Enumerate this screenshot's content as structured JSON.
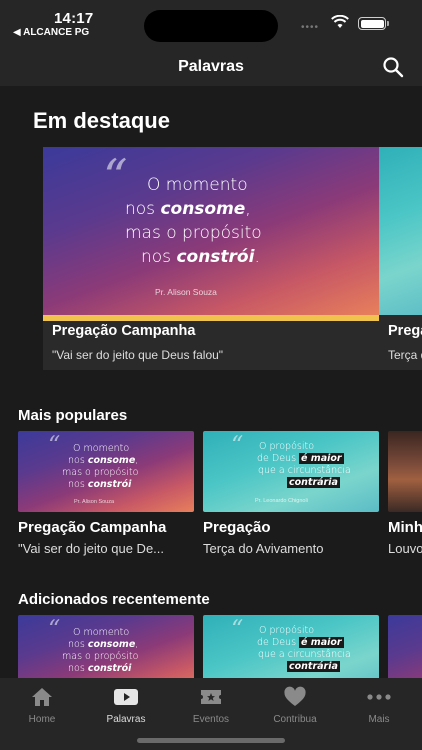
{
  "status": {
    "time": "14:17",
    "back_app": "◀ ALCANCE PG"
  },
  "nav": {
    "title": "Palavras"
  },
  "featured": {
    "section_title": "Em destaque",
    "cards": [
      {
        "title": "Pregação Campanha",
        "subtitle": "\"Vai ser do jeito que Deus falou\"",
        "art": {
          "line1": "O momento",
          "line2a": "nos ",
          "line2b": "consome",
          "line2c": ",",
          "line3": "mas o propósito",
          "line4a": "nos ",
          "line4b": "constrói",
          "line4c": ".",
          "author": "Pr. Alison Souza"
        }
      },
      {
        "title": "Pregação",
        "subtitle": "Terça do Avivamento"
      }
    ]
  },
  "popular": {
    "section_title": "Mais populares",
    "cards": [
      {
        "title": "Pregação Campanha",
        "subtitle": "\"Vai ser do jeito que De...",
        "art": {
          "line1": "O momento",
          "line2a": "nos ",
          "line2b": "consome",
          "line2c": ",",
          "line3": "mas o propósito",
          "line4a": "nos ",
          "line4b": "constrói",
          "author": "Pr. Alison Souza"
        }
      },
      {
        "title": "Pregação",
        "subtitle": "Terça do Avivamento",
        "art": {
          "line1": "O propósito",
          "line2a": "de Deus ",
          "line2b": "é maior",
          "line3": "que a circunstância",
          "line4": "contrária",
          "author": "Pr. Leonardo Chignoli"
        }
      },
      {
        "title": "Minh",
        "subtitle": "Louvo"
      }
    ]
  },
  "recent": {
    "section_title": "Adicionados recentemente",
    "cards": [
      {
        "art": {
          "line1": "O momento",
          "line2a": "nos ",
          "line2b": "consome",
          "line2c": ",",
          "line3": "mas o propósito",
          "line4a": "nos ",
          "line4b": "constrói"
        }
      },
      {
        "art": {
          "line1": "O propósito",
          "line2a": "de Deus ",
          "line2b": "é maior",
          "line3": "que a circunstância",
          "line4": "contrária"
        }
      }
    ]
  },
  "tabs": [
    {
      "label": "Home",
      "icon": "home-icon",
      "active": false
    },
    {
      "label": "Palavras",
      "icon": "play-icon",
      "active": true
    },
    {
      "label": "Eventos",
      "icon": "ticket-icon",
      "active": false
    },
    {
      "label": "Contribua",
      "icon": "heart-icon",
      "active": false
    },
    {
      "label": "Mais",
      "icon": "more-icon",
      "active": false
    }
  ],
  "colors": {
    "background": "#1b1b1b",
    "bar": "#262626",
    "accent_band": "#f0c34e"
  }
}
